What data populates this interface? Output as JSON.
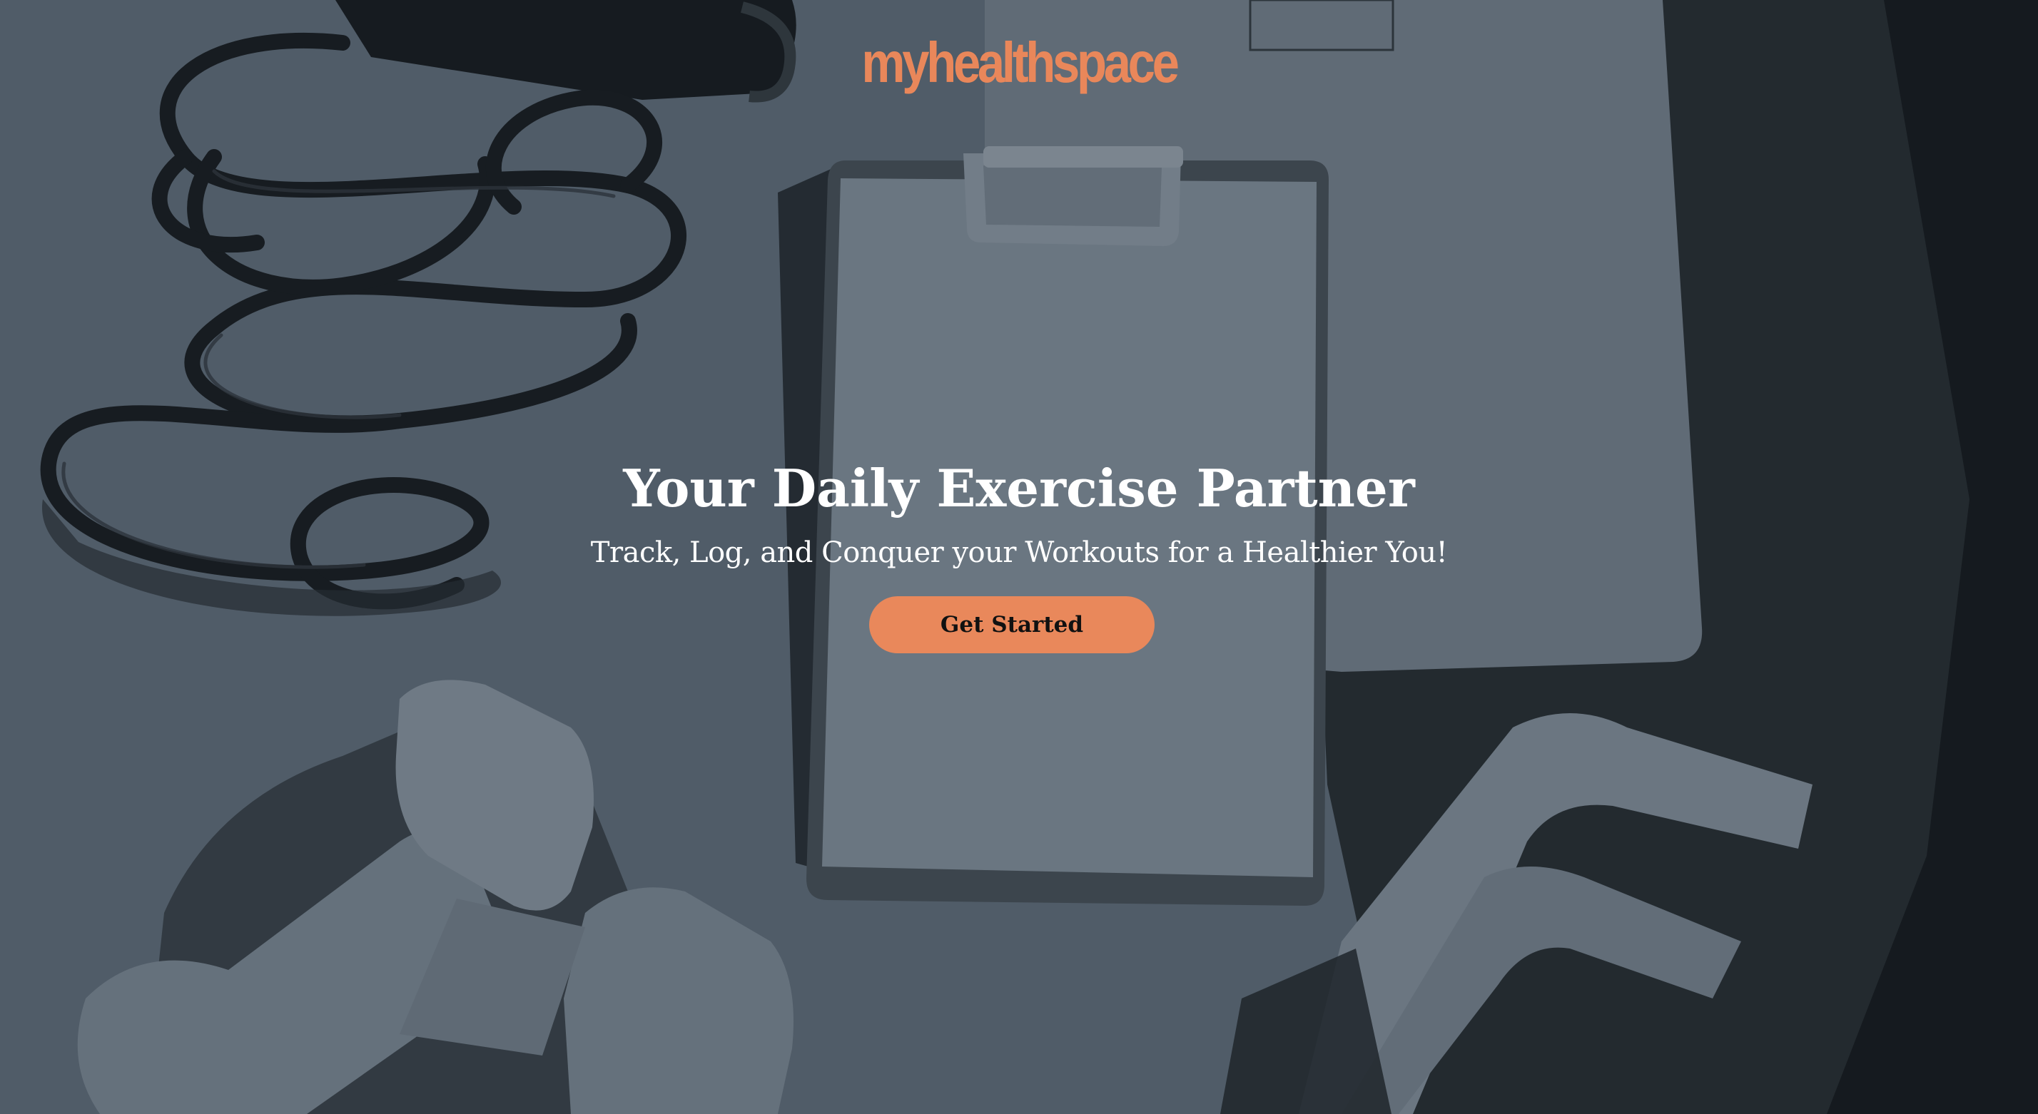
{
  "brand": {
    "logo_text": "myhealthspace",
    "accent_color": "#e9875a"
  },
  "hero": {
    "headline": "Your Daily Exercise Partner",
    "subheadline": "Track, Log, and Conquer your Workouts for a Healthier You!",
    "cta_label": "Get Started",
    "cta_color": "#e9885b"
  },
  "background": {
    "overlay_color": "#56616d",
    "depicts": [
      "jump-rope",
      "clipboard",
      "notebook",
      "dumbbells",
      "resistance-band",
      "exercise-mat"
    ]
  }
}
